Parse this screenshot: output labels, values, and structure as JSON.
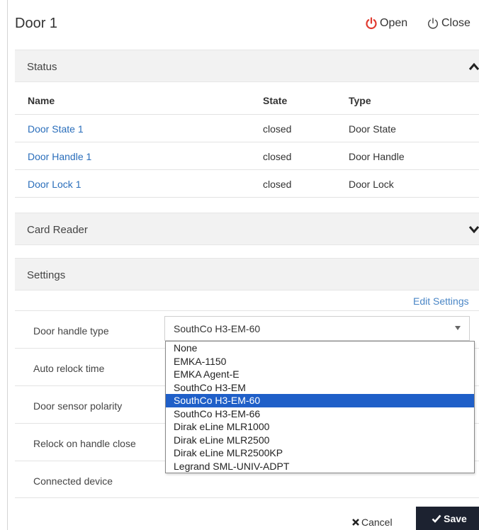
{
  "header": {
    "title": "Door 1",
    "open_label": "Open",
    "close_label": "Close",
    "open_icon_color": "#e03a2f"
  },
  "status_panel": {
    "title": "Status",
    "columns": [
      "Name",
      "State",
      "Type"
    ],
    "rows": [
      {
        "name": "Door State 1",
        "state": "closed",
        "type": "Door State"
      },
      {
        "name": "Door Handle 1",
        "state": "closed",
        "type": "Door Handle"
      },
      {
        "name": "Door Lock 1",
        "state": "closed",
        "type": "Door Lock"
      }
    ]
  },
  "card_reader_panel": {
    "title": "Card Reader"
  },
  "settings_panel": {
    "title": "Settings",
    "edit_label": "Edit Settings",
    "fields": [
      {
        "label": "Door handle type"
      },
      {
        "label": "Auto relock time"
      },
      {
        "label": "Door sensor polarity"
      },
      {
        "label": "Relock on handle close"
      },
      {
        "label": "Connected device"
      }
    ],
    "handle_type_value": "SouthCo H3-EM-60",
    "options": [
      "None",
      "EMKA-1150",
      "EMKA Agent-E",
      "SouthCo H3-EM",
      "SouthCo H3-EM-60",
      "SouthCo H3-EM-66",
      "Dirak eLine MLR1000",
      "Dirak eLine MLR2500",
      "Dirak eLine MLR2500KP",
      "Legrand SML-UNIV-ADPT"
    ],
    "selected_option_index": 4,
    "selection_color": "#1f5fc8"
  },
  "footer": {
    "cancel_label": "Cancel",
    "save_label": "Save"
  }
}
